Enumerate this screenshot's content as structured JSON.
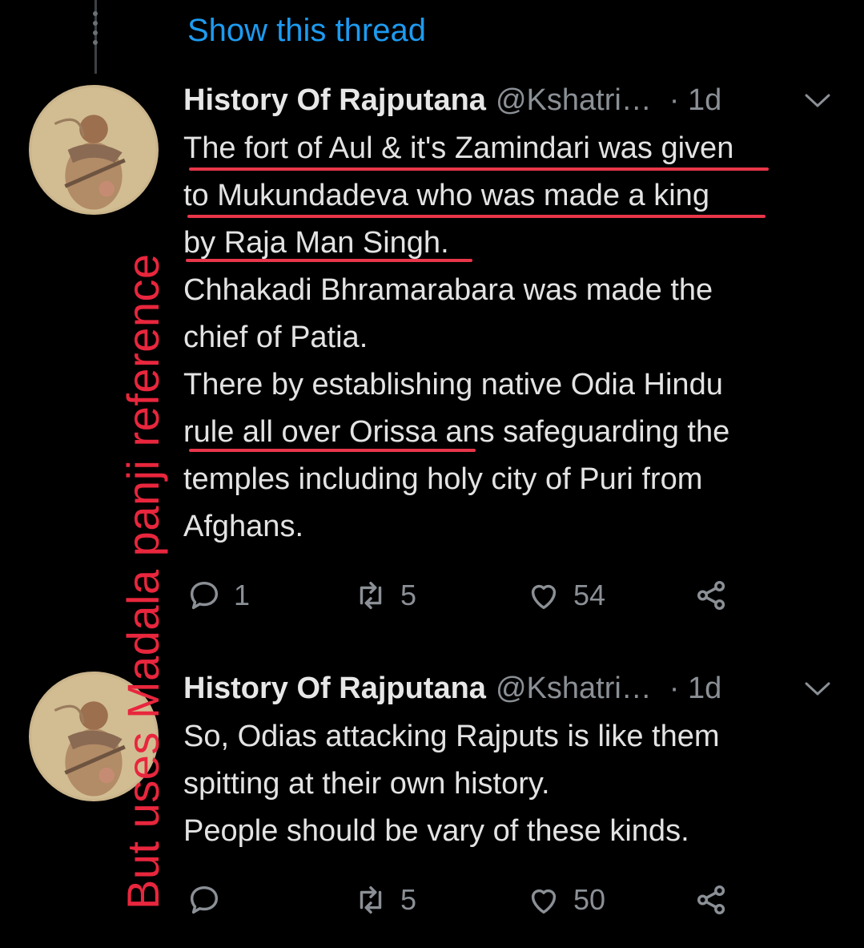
{
  "thread": {
    "show_thread_label": "Show this thread"
  },
  "tweets": [
    {
      "name": "History Of Rajputana",
      "handle": "@Kshatri…",
      "time": "· 1d",
      "lines": [
        "The fort of Aul & it's Zamindari was given",
        "to Mukundadeva who was made a king",
        "by Raja Man Singh.",
        "Chhakadi Bhramarabara was made the",
        "chief of Patia.",
        "There by establishing native Odia Hindu",
        "rule all over Orissa ans safeguarding the",
        "temples including holy city of Puri from",
        "Afghans."
      ],
      "reply_count": "1",
      "retweet_count": "5",
      "like_count": "54"
    },
    {
      "name": "History Of Rajputana",
      "handle": "@Kshatri…",
      "time": "· 1d",
      "lines": [
        "So, Odias attacking Rajputs is like them",
        "spitting at their own history.",
        "People should be vary of these kinds."
      ],
      "reply_count": "",
      "retweet_count": "5",
      "like_count": "50"
    }
  ],
  "annotation": {
    "vertical_text": "But uses Madala panji reference",
    "color": "#e8263d"
  },
  "colors": {
    "background": "#000000",
    "link": "#1d9bf0",
    "muted": "#8b9096",
    "underline": "#e8364a"
  },
  "icons": [
    "reply-icon",
    "retweet-icon",
    "like-icon",
    "share-icon",
    "chevron-down-icon"
  ]
}
